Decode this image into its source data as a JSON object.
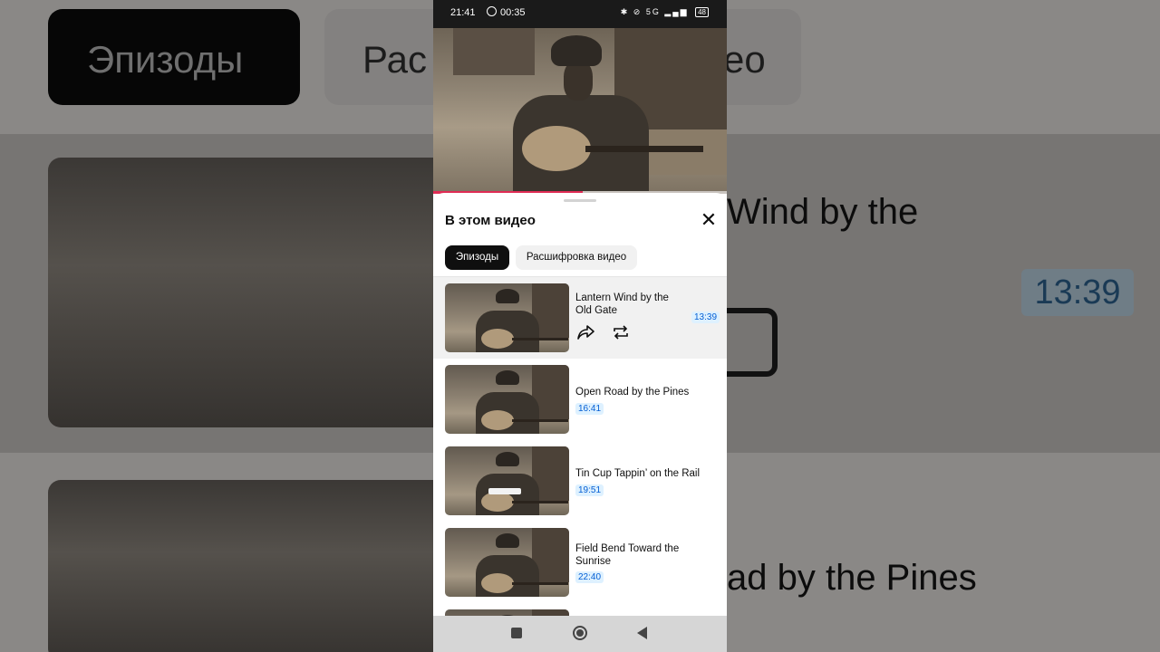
{
  "status_bar": {
    "time": "21:41",
    "timer": "00:35",
    "network": "5G",
    "battery": "48"
  },
  "background_mirror": {
    "chip_active": "Эпизоды",
    "chip_inactive": "Рас",
    "chip_inactive_tail": "ео",
    "row1_title_fragment": "Wind by the",
    "row1_time": "13:39",
    "row2_title_fragment": "ad by the Pines"
  },
  "player": {
    "progress_fraction": 0.51
  },
  "sheet": {
    "title": "В этом видео",
    "close_icon": "close-icon",
    "tabs": [
      {
        "label": "Эпизоды",
        "active": true
      },
      {
        "label": "Расшифровка видео",
        "active": false
      }
    ]
  },
  "episodes": [
    {
      "title": "Lantern Wind by the Old Gate",
      "time": "13:39",
      "selected": true
    },
    {
      "title": "Open Road by the Pines",
      "time": "16:41",
      "selected": false
    },
    {
      "title": "Tin Cup Tappin’ on the Rail",
      "time": "19:51",
      "selected": false
    },
    {
      "title": "Field Bend Toward the Sunrise",
      "time": "22:40",
      "selected": false
    }
  ],
  "colors": {
    "accent_progress": "#e02c55",
    "timestamp_text": "#065fd4",
    "timestamp_bg": "#def1ff"
  }
}
